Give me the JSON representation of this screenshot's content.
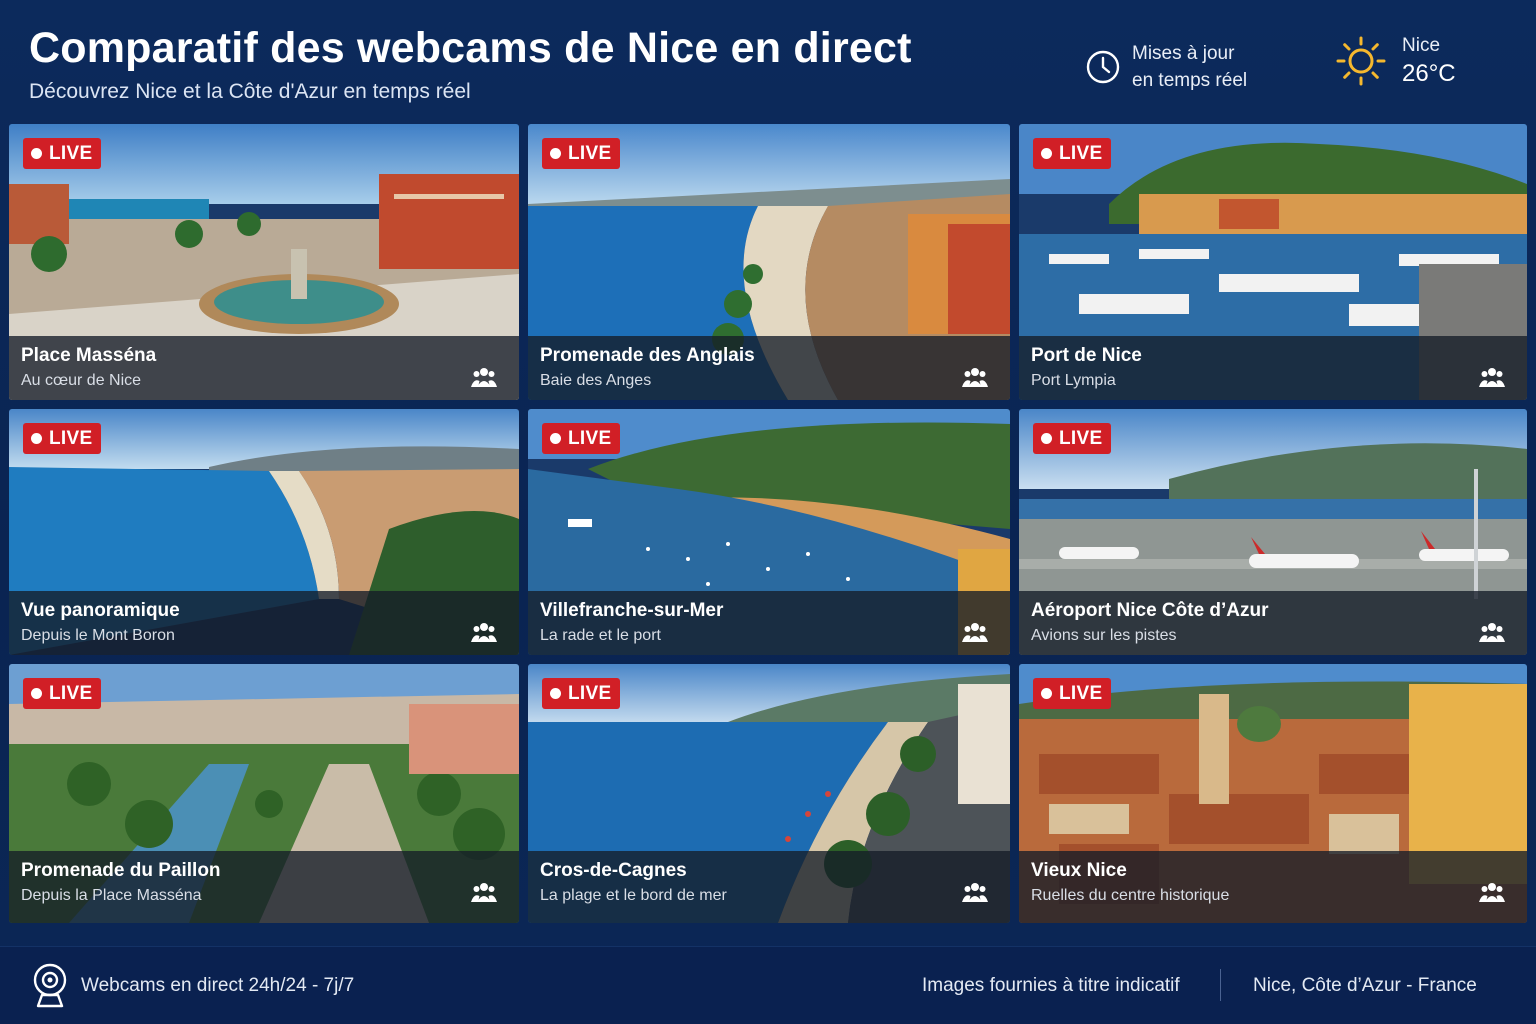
{
  "header": {
    "title": "Comparatif des webcams de Nice en direct",
    "subtitle": "Découvrez Nice et la Côte d'Azur en temps réel",
    "updates_line1": "Mises à jour",
    "updates_line2": "en temps réel",
    "weather_city": "Nice",
    "weather_temp": "26°C"
  },
  "live_label": "LIVE",
  "webcams": [
    {
      "title": "Place Masséna",
      "subtitle": "Au cœur de Nice"
    },
    {
      "title": "Promenade des Anglais",
      "subtitle": "Baie des Anges"
    },
    {
      "title": "Port de Nice",
      "subtitle": "Port Lympia"
    },
    {
      "title": "Vue panoramique",
      "subtitle": "Depuis le Mont Boron"
    },
    {
      "title": "Villefranche-sur-Mer",
      "subtitle": "La rade et le port"
    },
    {
      "title": "Aéroport Nice Côte d’Azur",
      "subtitle": "Avions sur les pistes"
    },
    {
      "title": "Promenade du Paillon",
      "subtitle": "Depuis la Place Masséna"
    },
    {
      "title": "Cros-de-Cagnes",
      "subtitle": "La plage et le bord de mer"
    },
    {
      "title": "Vieux Nice",
      "subtitle": "Ruelles du centre historique"
    }
  ],
  "footer": {
    "left": "Webcams en direct 24h/24 - 7j/7",
    "middle": "Images fournies à titre indicatif",
    "right": "Nice, Côte d’Azur - France"
  },
  "colors": {
    "background": "#0b2756",
    "live_badge": "#d11f26",
    "sun": "#f5b82e"
  }
}
